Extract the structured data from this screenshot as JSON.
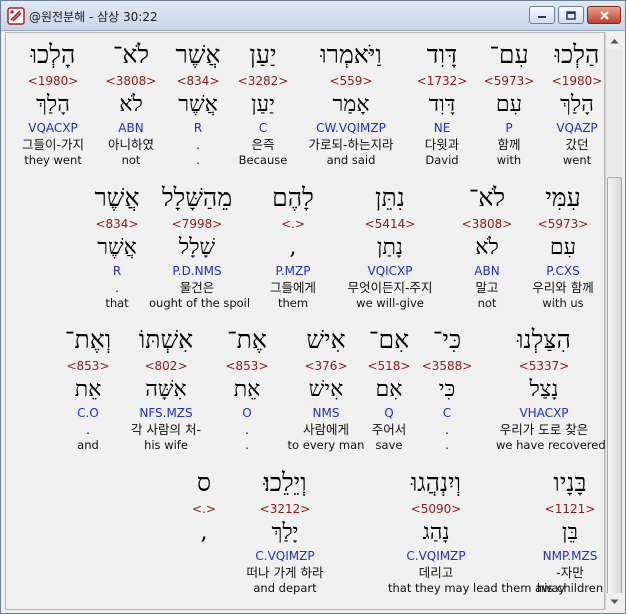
{
  "window": {
    "title": "@원전분해 - 삼상 30:22",
    "minimize_label": "minimize",
    "maximize_label": "maximize",
    "close_label": "close"
  },
  "rows": [
    {
      "words": [
        {
          "heb": "הַלְכוּ",
          "strong": "<1980>",
          "lemma": "הָלַךְ",
          "parse": "VQAZP",
          "kor": "갔던",
          "eng": "went"
        },
        {
          "heb": "עִם־",
          "strong": "<5973>",
          "lemma": "עִם",
          "parse": "P",
          "kor": "함께",
          "eng": "with"
        },
        {
          "heb": "דָּוִד",
          "strong": "<1732>",
          "lemma": "דָּוִד",
          "parse": "NE",
          "kor": "다윗과",
          "eng": "David"
        },
        {
          "heb": "וַיֹּאמְרוּ",
          "strong": "<559>",
          "lemma": "אָמַר",
          "parse": "CW.VQIMZP",
          "kor": "가로되-하는지라",
          "eng": "and said"
        },
        {
          "heb": "יַעַן",
          "strong": "<3282>",
          "lemma": "יַעַן",
          "parse": "C",
          "kor": "은즉",
          "eng": "Because"
        },
        {
          "heb": "אֲשֶׁר",
          "strong": "<834>",
          "lemma": "אֲשֶׁר",
          "parse": "R",
          "kor": ".",
          "eng": "."
        },
        {
          "heb": "לֹא־",
          "strong": "<3808>",
          "lemma": "לֹא",
          "parse": "ABN",
          "kor": "아니하였",
          "eng": "not"
        },
        {
          "heb": "הָלְכוּ",
          "strong": "<1980>",
          "lemma": "הָלַךְ",
          "parse": "VQACXP",
          "kor": "그들이-가지",
          "eng": "they went"
        }
      ]
    },
    {
      "words": [
        {
          "heb": "עִמִּי",
          "strong": "<5973>",
          "lemma": "עִם",
          "parse": "P.CXS",
          "kor": "우리와 함께",
          "eng": "with us"
        },
        {
          "heb": "לֹא־",
          "strong": "<3808>",
          "lemma": "לֹא",
          "parse": "ABN",
          "kor": "말고",
          "eng": "not"
        },
        {
          "heb": "נִתֵּן",
          "strong": "<5414>",
          "lemma": "נָתַן",
          "parse": "VQICXP",
          "kor": "무엇이든지-주지",
          "eng": "we will-give"
        },
        {
          "heb": "לָהֶם",
          "strong": "<.>",
          "lemma": ",",
          "parse": "P.MZP",
          "kor": "그들에게",
          "eng": "them"
        },
        {
          "heb": "מֵהַשָּׁלָל",
          "strong": "<7998>",
          "lemma": "שָׁלָל",
          "parse": "P.D.NMS",
          "kor": "물건은",
          "eng": "ought of the spoil"
        },
        {
          "heb": "אֲשֶׁר",
          "strong": "<834>",
          "lemma": "אֲשֶׁר",
          "parse": "R",
          "kor": ".",
          "eng": "that"
        }
      ]
    },
    {
      "words": [
        {
          "heb": "הִצַּלְנוּ",
          "strong": "<5337>",
          "lemma": "נָצַל",
          "parse": "VHACXP",
          "kor": "우리가 도로 찾은",
          "eng": "we have recovered"
        },
        {
          "heb": "כִּי־",
          "strong": "<3588>",
          "lemma": "כִּי",
          "parse": "C",
          "kor": ".",
          "eng": "."
        },
        {
          "heb": "אִם־",
          "strong": "<518>",
          "lemma": "אִם",
          "parse": "Q",
          "kor": "주어서",
          "eng": "save"
        },
        {
          "heb": "אִישׁ",
          "strong": "<376>",
          "lemma": "אִישׁ",
          "parse": "NMS",
          "kor": "사람에게",
          "eng": "to every man"
        },
        {
          "heb": "אֶת־",
          "strong": "<853>",
          "lemma": "אֵת",
          "parse": "O",
          "kor": ".",
          "eng": "."
        },
        {
          "heb": "אִשְׁתּוֹ",
          "strong": "<802>",
          "lemma": "אִשָּׁה",
          "parse": "NFS.MZS",
          "kor": "각 사람의 처-",
          "eng": "his wife"
        },
        {
          "heb": "וְאֶת־",
          "strong": "<853>",
          "lemma": "אֵת",
          "parse": "C.O",
          "kor": ".",
          "eng": "and"
        }
      ]
    },
    {
      "words": [
        {
          "heb": "בָּנָיו",
          "strong": "<1121>",
          "lemma": "בֵּן",
          "parse": "NMP.MZS",
          "kor": "-자만",
          "eng": "his children"
        },
        {
          "heb": "וְיִנְהֲגוּ",
          "strong": "<5090>",
          "lemma": "נָהַג",
          "parse": "C.VQIMZP",
          "kor": "데리고",
          "eng": "that they may lead them away"
        },
        {
          "heb": "וְיֵלֵכוּ׃",
          "strong": "<3212>",
          "lemma": "יָלַךְ",
          "parse": "C.VQIMZP",
          "kor": "떠나 가게 하라",
          "eng": "and depart"
        },
        {
          "heb": "ס",
          "strong": "<.>",
          "lemma": ",",
          "parse": "",
          "kor": "",
          "eng": ""
        }
      ]
    }
  ]
}
